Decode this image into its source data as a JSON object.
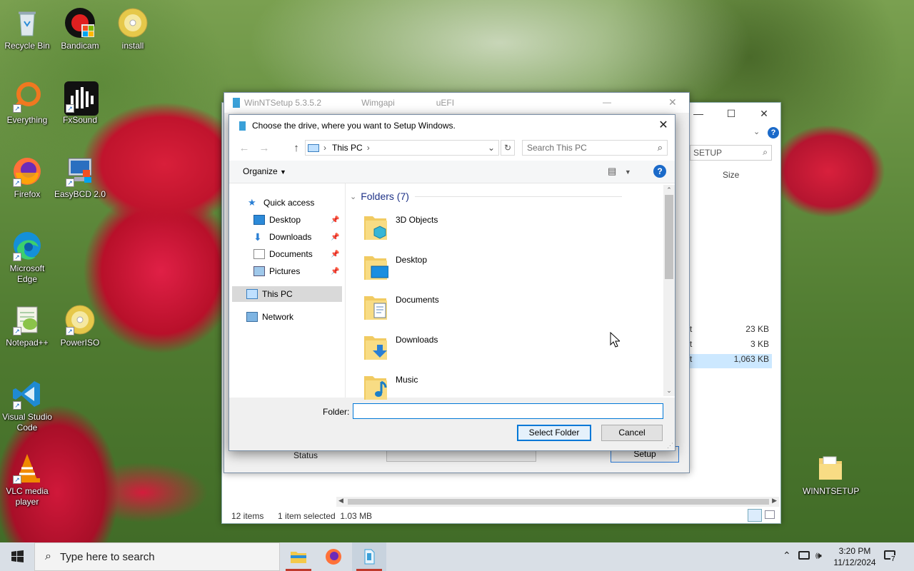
{
  "desktop_icons": [
    {
      "label": "Recycle Bin"
    },
    {
      "label": "Bandicam"
    },
    {
      "label": "install"
    },
    {
      "label": "Everything"
    },
    {
      "label": "FxSound"
    },
    {
      "label": "Firefox"
    },
    {
      "label": "EasyBCD 2.0"
    },
    {
      "label": "Microsoft Edge"
    },
    {
      "label": "Notepad++"
    },
    {
      "label": "PowerISO"
    },
    {
      "label": "Visual Studio Code"
    },
    {
      "label": "VLC media player"
    },
    {
      "label": "WINNTSETUP"
    }
  ],
  "explorer": {
    "search_text": "SETUP",
    "size_header": "Size",
    "rows": [
      {
        "k": "t",
        "v": "23 KB"
      },
      {
        "k": "t",
        "v": "3 KB"
      },
      {
        "k": "t",
        "v": "1,063 KB"
      }
    ],
    "status_items": "12 items",
    "status_selected": "1 item selected  1.03 MB"
  },
  "winntsetup": {
    "title": "WinNTSetup 5.3.5.2",
    "mode1": "Wimgapi",
    "mode2": "uEFI",
    "status_label": "Status",
    "setup_button": "Setup"
  },
  "dialog": {
    "title": "Choose the drive, where you want to Setup Windows.",
    "address": "This PC",
    "search_placeholder": "Search This PC",
    "organize": "Organize",
    "nav": [
      {
        "label": "Quick access"
      },
      {
        "label": "Desktop"
      },
      {
        "label": "Downloads"
      },
      {
        "label": "Documents"
      },
      {
        "label": "Pictures"
      },
      {
        "label": "This PC"
      },
      {
        "label": "Network"
      }
    ],
    "group_header": "Folders (7)",
    "folders": [
      {
        "label": "3D Objects"
      },
      {
        "label": "Desktop"
      },
      {
        "label": "Documents"
      },
      {
        "label": "Downloads"
      },
      {
        "label": "Music"
      }
    ],
    "folder_label": "Folder:",
    "folder_value": "",
    "select_button": "Select Folder",
    "cancel_button": "Cancel"
  },
  "taskbar": {
    "search_placeholder": "Type here to search",
    "time": "3:20 PM",
    "date": "11/12/2024",
    "notifications": "7"
  },
  "colors": {
    "accent": "#0078d7",
    "group_header": "#1e3287"
  }
}
